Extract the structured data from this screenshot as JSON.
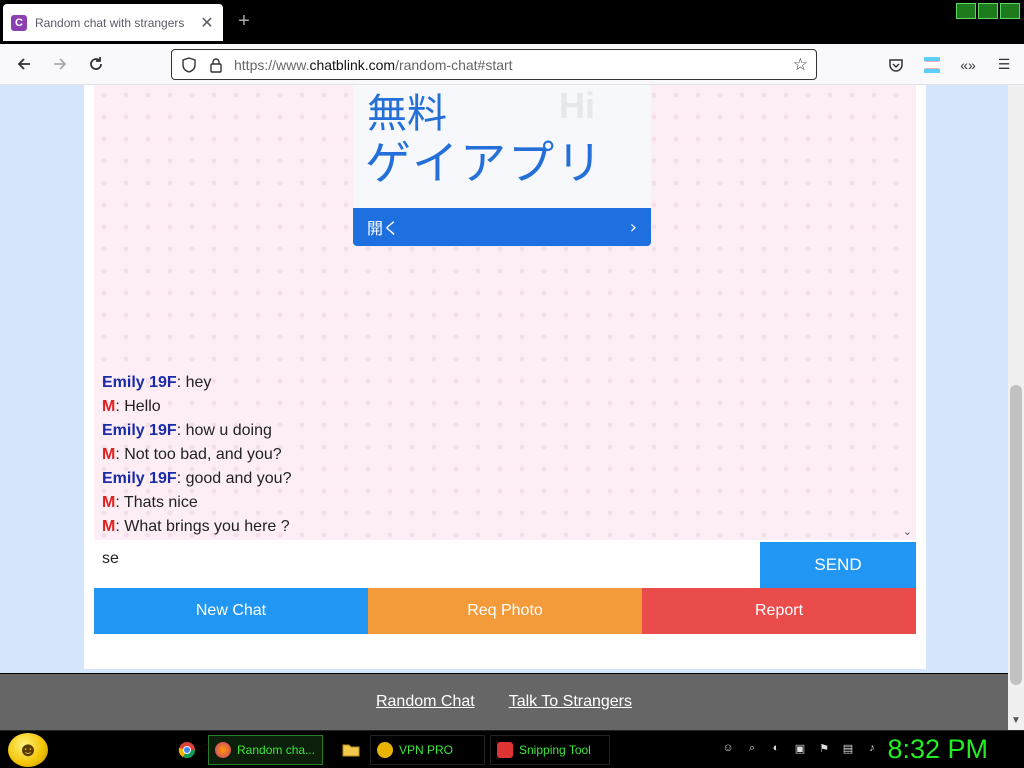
{
  "browser": {
    "tab_title": "Random chat with strangers",
    "tab_favicon_letter": "C",
    "new_tab_label": "+",
    "tab_close_label": "✕",
    "url_prefix": "https://www.",
    "url_domain": "chatblink.com",
    "url_path": "/random-chat#start"
  },
  "ad": {
    "line1": "無料",
    "line2": "ゲイアプリ",
    "bg_text": "Hi",
    "button_label": "開く",
    "button_chevron": "›"
  },
  "chat": {
    "messages": [
      {
        "sender": "Emily 19F",
        "role": "stranger",
        "text": ": hey"
      },
      {
        "sender": "M",
        "role": "me",
        "text": ": Hello"
      },
      {
        "sender": "Emily 19F",
        "role": "stranger",
        "text": ": how u doing"
      },
      {
        "sender": "M",
        "role": "me",
        "text": ": Not too bad, and you?"
      },
      {
        "sender": "Emily 19F",
        "role": "stranger",
        "text": ": good and you?"
      },
      {
        "sender": "M",
        "role": "me",
        "text": ": Thats nice"
      },
      {
        "sender": "M",
        "role": "me",
        "text": ": What brings you here ?"
      }
    ],
    "input_value": "se",
    "send_label": "SEND",
    "colors": {
      "stranger": "#1a2aa8",
      "me": "#e0201e"
    }
  },
  "actions": {
    "new_chat": "New Chat",
    "req_photo": "Req Photo",
    "report": "Report",
    "colors": {
      "new_chat": "#2196f3",
      "req_photo": "#f39a3a",
      "report": "#ea4b4b"
    }
  },
  "footer": {
    "link1": "Random Chat",
    "link2": "Talk To Strangers"
  },
  "taskbar": {
    "items": [
      {
        "label": "Random cha...",
        "icon": "firefox-icon"
      },
      {
        "label": "VPN PRO",
        "icon": "vpn-icon"
      },
      {
        "label": "Snipping Tool",
        "icon": "snipping-tool-icon"
      }
    ],
    "clock": "8:32 PM"
  }
}
